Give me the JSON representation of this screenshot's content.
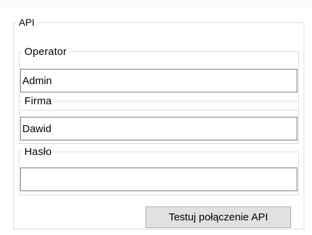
{
  "api_group": {
    "legend": "API"
  },
  "operator": {
    "legend": "Operator",
    "value": "Admin"
  },
  "firma": {
    "legend": "Firma",
    "value": "Dawid"
  },
  "haslo": {
    "legend": "Hasło",
    "value": ""
  },
  "test_button": {
    "label": "Testuj połączenie API"
  }
}
